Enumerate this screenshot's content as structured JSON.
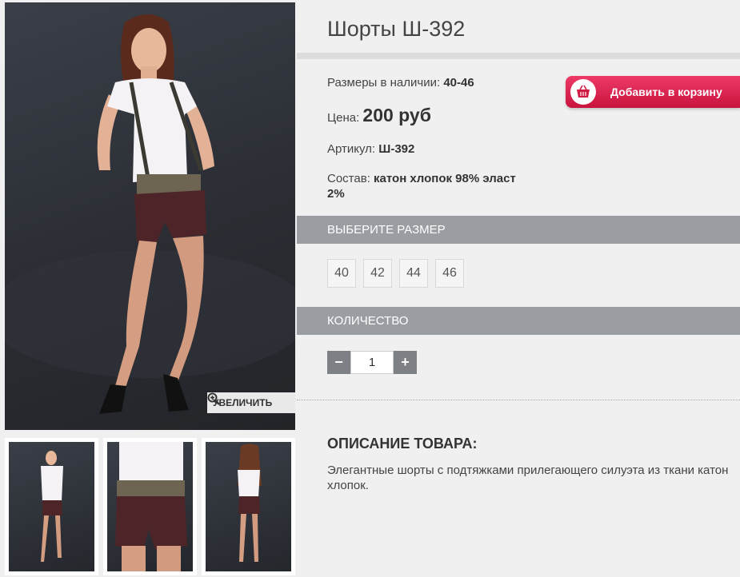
{
  "product": {
    "title": "Шорты Ш-392",
    "sizes_label": "Размеры в наличии:",
    "sizes_value": "40-46",
    "price_label": "Цена:",
    "price_value": "200 руб",
    "sku_label": "Артикул:",
    "sku_value": "Ш-392",
    "composition_label": "Состав:",
    "composition_value_1": "катон хлопок 98% эласт",
    "composition_value_2": "2%"
  },
  "cart": {
    "label": "Добавить в корзину",
    "icon": "basket-icon",
    "color": "#e0234f"
  },
  "gallery": {
    "zoom_label": "УВЕЛИЧИТЬ",
    "zoom_icon": "magnifier-plus-icon"
  },
  "size_section": {
    "title": "ВЫБЕРИТЕ РАЗМЕР",
    "options": [
      "40",
      "42",
      "44",
      "46"
    ]
  },
  "quantity": {
    "title": "КОЛИЧЕСТВО",
    "minus": "−",
    "plus": "+",
    "value": "1"
  },
  "description": {
    "title": "ОПИСАНИЕ ТОВАРА:",
    "text": "Элегантные шорты с подтяжками прилегающего силуэта из ткани катон хлопок."
  },
  "colors": {
    "section_bar": "#9a9da2",
    "qty_btn": "#7d8085",
    "background": "#f0f0f0"
  }
}
